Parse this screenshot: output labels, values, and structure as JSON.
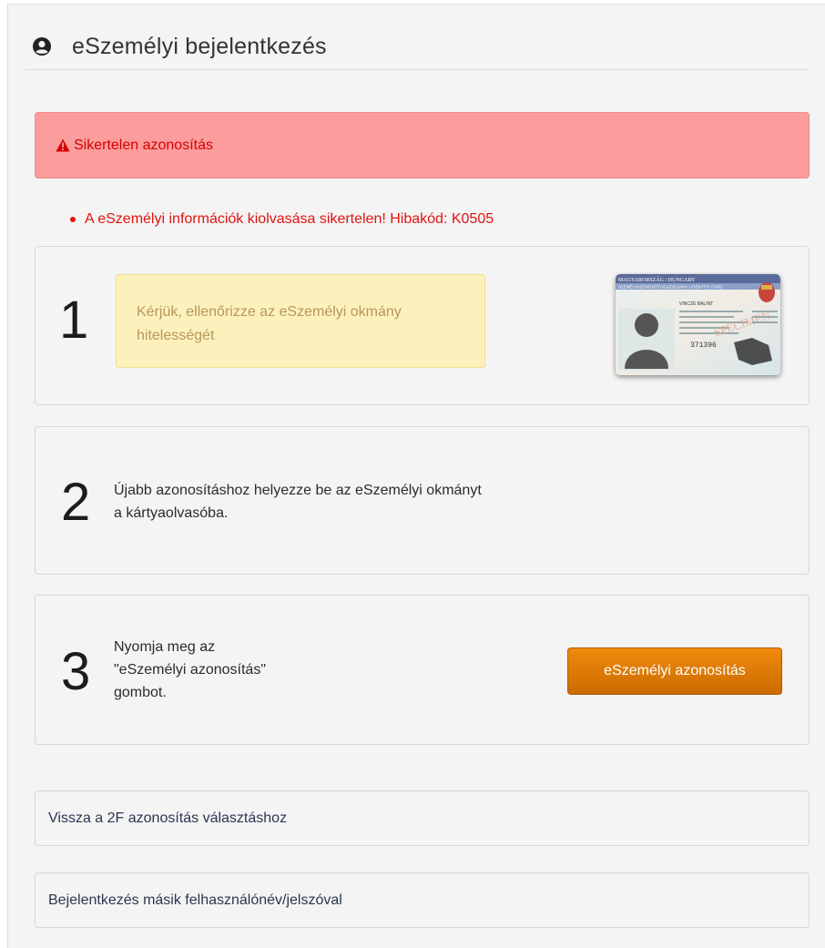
{
  "header": {
    "title": "eSzemélyi bejelentkezés",
    "icon": "user-circle-icon"
  },
  "alert": {
    "icon": "warning-triangle-icon",
    "text": "Sikertelen azonosítás",
    "color": "#d70000",
    "background": "#fc9d9d"
  },
  "error": {
    "text": "A eSzemélyi információk kiolvasása sikertelen! Hibakód: K0505"
  },
  "steps": [
    {
      "number": "1",
      "text": "Kérjük, ellenőrizze az eSzemélyi okmány hitelességét"
    },
    {
      "number": "2",
      "text": "Újabb azonosításhoz helyezze be az eSzemélyi okmányt\na kártyaolvasóba."
    },
    {
      "number": "3",
      "text": "Nyomja meg az\n\"eSzemélyi azonosítás\"\ngombot.",
      "button_label": "eSzemélyi azonosítás"
    }
  ],
  "card": {
    "header_text": "MAGYARORSZÁG / HUNGARY",
    "subheader_text": "SZEMÉLYAZONOSÍTÓ IGAZOLVÁNY / IDENTITY CARD",
    "name_text": "VINCZE BALINT",
    "number_text": "371396",
    "watermark_text": "SPECIMEN"
  },
  "links": [
    {
      "label": "Vissza a 2F azonosítás választáshoz"
    },
    {
      "label": "Bejelentkezés másik felhasználónév/jelszóval"
    }
  ],
  "colors": {
    "accent": "#e07a06",
    "error": "#e0140f",
    "warn_text": "#b7975a"
  }
}
